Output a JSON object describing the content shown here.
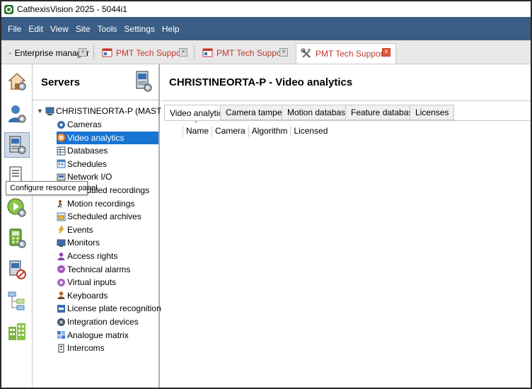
{
  "window": {
    "title": "CathexisVision 2025 - 5044i1"
  },
  "menu": [
    "File",
    "Edit",
    "View",
    "Site",
    "Tools",
    "Settings",
    "Help"
  ],
  "doc_tabs": [
    {
      "label": "Enterprise manager",
      "red": false,
      "active": false
    },
    {
      "label": "PMT Tech Support",
      "red": true,
      "active": false
    },
    {
      "label": "PMT Tech Support",
      "red": true,
      "active": false
    },
    {
      "label": "PMT Tech Support",
      "red": true,
      "active": true
    }
  ],
  "close_glyph": "×",
  "servers_panel": {
    "title": "Servers"
  },
  "tree": {
    "root": "CHRISTINEORTA-P (MASTER)",
    "items": [
      {
        "label": "Cameras",
        "icon": "camera-icon"
      },
      {
        "label": "Video analytics",
        "icon": "video-analytics-icon",
        "selected": true
      },
      {
        "label": "Databases",
        "icon": "database-icon"
      },
      {
        "label": "Schedules",
        "icon": "schedule-icon"
      },
      {
        "label": "Network I/O",
        "icon": "network-io-icon"
      },
      {
        "label": "Scheduled recordings",
        "icon": "scheduled-recording-icon"
      },
      {
        "label": "Motion recordings",
        "icon": "motion-recording-icon"
      },
      {
        "label": "Scheduled archives",
        "icon": "scheduled-archive-icon"
      },
      {
        "label": "Events",
        "icon": "event-icon"
      },
      {
        "label": "Monitors",
        "icon": "monitor-icon"
      },
      {
        "label": "Access rights",
        "icon": "access-rights-icon"
      },
      {
        "label": "Technical alarms",
        "icon": "technical-alarm-icon"
      },
      {
        "label": "Virtual inputs",
        "icon": "virtual-input-icon"
      },
      {
        "label": "Keyboards",
        "icon": "keyboard-icon"
      },
      {
        "label": "License plate recognition",
        "icon": "lpr-icon"
      },
      {
        "label": "Integration devices",
        "icon": "integration-device-icon"
      },
      {
        "label": "Analogue matrix",
        "icon": "analogue-matrix-icon"
      },
      {
        "label": "Intercoms",
        "icon": "intercom-icon"
      }
    ]
  },
  "tooltip": {
    "text": "Configure resource panel"
  },
  "main": {
    "title": "CHRISTINEORTA-P - Video analytics",
    "tabs": [
      "Video analytics",
      "Camera tamper",
      "Motion database",
      "Feature database",
      "Licenses"
    ],
    "columns": [
      "Name",
      "Camera",
      "Algorithm",
      "Licensed"
    ]
  },
  "colors": {
    "menubar": "#3a5d85",
    "selection": "#1874d2",
    "tab_text_red": "#c0392b",
    "close_active": "#e05a3a"
  }
}
